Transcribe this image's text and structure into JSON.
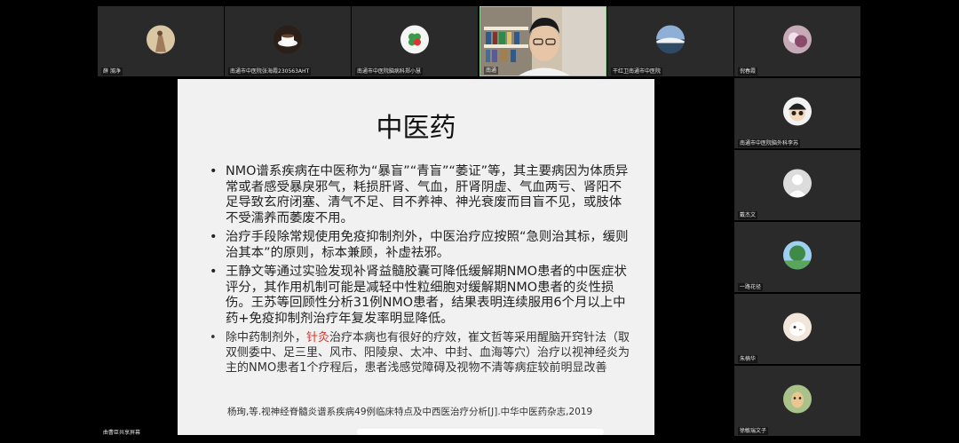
{
  "participants_top": [
    {
      "name": "薛 漪净",
      "avatar": "painting-icon",
      "color": "#c9b08a"
    },
    {
      "name": "南通市中医院张海霞230563AHT",
      "avatar": "coffee-icon",
      "color": "#3a2a22"
    },
    {
      "name": "南通市中医院脑病科郑小慧",
      "avatar": "clover-icon",
      "color": "#e8ece8"
    },
    {
      "name": "南通",
      "avatar": "video",
      "color": "#b8a48a"
    },
    {
      "name": "干红卫南通市中医院",
      "avatar": "landscape-icon",
      "color": "#6c8bb0"
    },
    {
      "name": "倪春霞",
      "avatar": "flower-icon",
      "color": "#b798a8"
    }
  ],
  "participants_side": [
    {
      "name": "南通市中医院脑外科李苏",
      "avatar": "cartoon-icon",
      "color": "#f0f0f0"
    },
    {
      "name": "戴杰文",
      "avatar": "default-avatar-icon",
      "color": "#d9d9d9"
    },
    {
      "name": "一路花径",
      "avatar": "tree-icon",
      "color": "#4f9a5a"
    },
    {
      "name": "朱楠华",
      "avatar": "bird-icon",
      "color": "#e8d6c8"
    },
    {
      "name": "徐敏瑞文子",
      "avatar": "alpaca-icon",
      "color": "#9bb27a"
    }
  ],
  "share_owner": "曲曹臣共享屏幕",
  "slide": {
    "title": "中医药",
    "bullets": [
      "NMO谱系疾病在中医称为“暴盲”“青盲”“萎证”等，其主要病因为体质异常或者感受暴戾邪气，耗损肝肾、气血，肝肾阴虚、气血两亏、肾阳不足导致玄府闭塞、清气不足、目不养神、神光衰废而目盲不见，或肢体不受濡养而萎废不用。",
      "治疗手段除常规使用免疫抑制剂外，中医治疗应按照“急则治其标，缓则治其本”的原则，标本兼顾，补虚祛邪。",
      "王静文等通过实验发现补肾益髓胶囊可降低缓解期NMO患者的中医症状评分，其作用机制可能是减轻中性粒细胞对缓解期NMO患者的炎性损伤。王苏等回顾性分析31例NMO患者，结果表明连续服用6个月以上中药+免疫抑制剂治疗年复发率明显降低。"
    ],
    "bullet4_pre": "除中药制剂外，",
    "bullet4_highlight": "针灸",
    "bullet4_post": "治疗本病也有很好的疗效，崔文哲等采用醒脑开窍针法（取双侧委中、足三里、风市、阳陵泉、太冲、中封、血海等穴）治疗以视神经炎为主的NMO患者1个疗程后，患者浅感觉障碍及视物不清等病症较前明显改善",
    "citation": "杨珣,等.视神经脊髓炎谱系疾病49例临床特点及中西医治疗分析[J].中华中医药杂志,2019",
    "highlight_color": "#d9342b"
  }
}
